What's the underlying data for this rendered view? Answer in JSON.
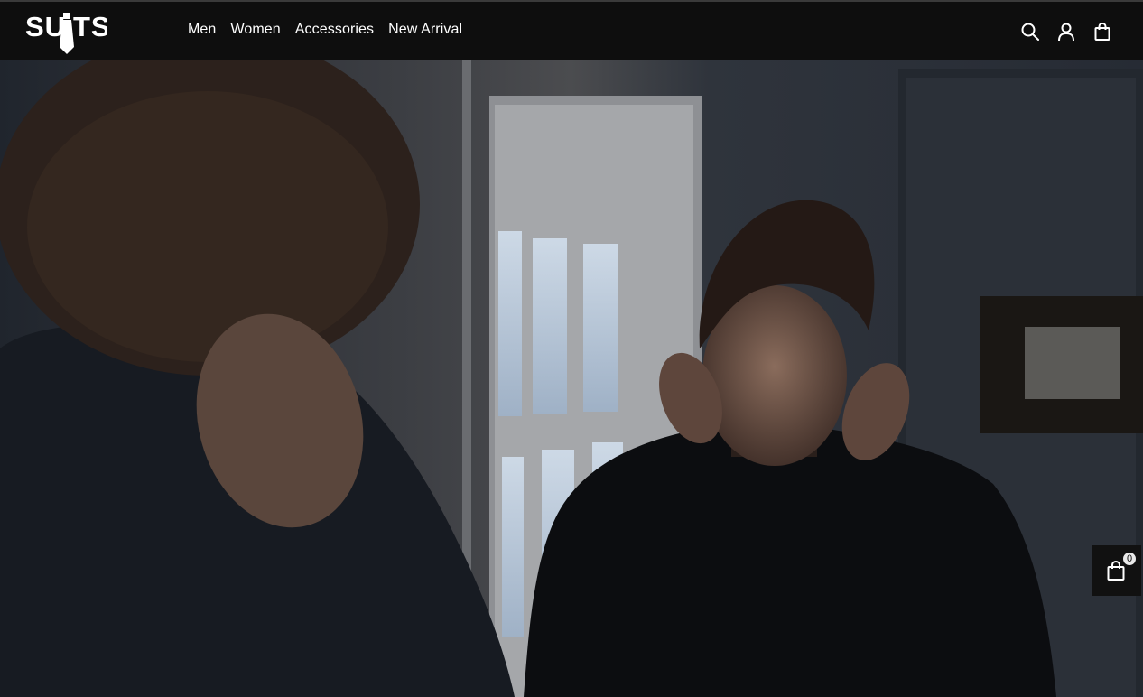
{
  "brand": {
    "logo_text": "SUITS"
  },
  "nav": {
    "items": [
      {
        "label": "Men"
      },
      {
        "label": "Women"
      },
      {
        "label": "Accessories"
      },
      {
        "label": "New Arrival"
      }
    ]
  },
  "header_icons": [
    "search-icon",
    "user-icon",
    "shopping-bag-icon"
  ],
  "floating_cart": {
    "icon": "shopping-bag-icon",
    "count": "0"
  },
  "colors": {
    "header_bg": "#0e0e0e",
    "text": "#ffffff",
    "cart_bg": "#111111"
  }
}
